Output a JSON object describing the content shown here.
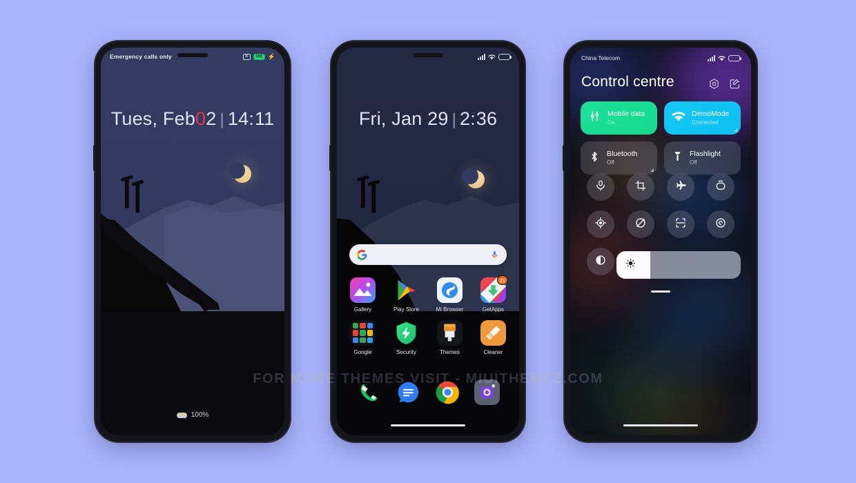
{
  "meta": {
    "background_color": "#a8b4fb",
    "watermark": "FOR MORE THEMES VISIT - MIUITHEMEZ.COM"
  },
  "lockscreen": {
    "statusbar": {
      "carrier": "Emergency calls only",
      "sim_icon": "no-sim-icon",
      "battery_level": "100",
      "charging_icon": "charging-bolt-icon"
    },
    "clock": {
      "weekday_month": "Tues, Feb",
      "day_red": "0",
      "day_rest": "2",
      "separator": "|",
      "hours": "14",
      "colon": ":",
      "minutes": "11"
    },
    "footer": {
      "battery_icon": "battery-charging-icon",
      "battery_text": "100%"
    }
  },
  "homescreen": {
    "statusbar": {
      "signal_icon": "signal-bars-icon",
      "wifi_icon": "wifi-icon",
      "battery_icon": "battery-icon"
    },
    "clock": {
      "weekday_month": "Fri, Jan",
      "day": "29",
      "separator": "|",
      "hours": "2",
      "colon": ":",
      "minutes": "36"
    },
    "search": {
      "logo_icon": "google-g-icon",
      "mic_icon": "microphone-icon",
      "placeholder": ""
    },
    "apps": [
      {
        "label": "Gallery",
        "icon": "gallery-icon",
        "badge": ""
      },
      {
        "label": "Play Store",
        "icon": "play-store-icon",
        "badge": ""
      },
      {
        "label": "Mi Browser",
        "icon": "mi-browser-icon",
        "badge": ""
      },
      {
        "label": "GetApps",
        "icon": "getapps-icon",
        "badge": "21"
      },
      {
        "label": "Google",
        "icon": "google-folder-icon",
        "badge": ""
      },
      {
        "label": "Security",
        "icon": "security-icon",
        "badge": ""
      },
      {
        "label": "Themes",
        "icon": "themes-icon",
        "badge": ""
      },
      {
        "label": "Cleaner",
        "icon": "cleaner-icon",
        "badge": ""
      }
    ],
    "dock": [
      {
        "label": "Phone",
        "icon": "phone-icon"
      },
      {
        "label": "Messages",
        "icon": "messages-icon"
      },
      {
        "label": "Chrome",
        "icon": "chrome-icon"
      },
      {
        "label": "Camera",
        "icon": "camera-icon"
      }
    ]
  },
  "controlcentre": {
    "statusbar": {
      "carrier": "China Telecom",
      "signal_icon": "signal-bars-icon",
      "wifi_icon": "wifi-icon",
      "battery_icon": "battery-icon"
    },
    "title": "Control centre",
    "actions": [
      {
        "name": "settings-icon"
      },
      {
        "name": "edit-icon"
      }
    ],
    "big_tiles": [
      {
        "title": "Mobile data",
        "subtitle": "On",
        "icon": "mobile-data-icon",
        "state": "on",
        "accent": "#17dd92"
      },
      {
        "title": "DemoMode",
        "subtitle": "Connected",
        "icon": "wifi-icon",
        "state": "on",
        "accent": "#12c4f2"
      },
      {
        "title": "Bluetooth",
        "subtitle": "Off",
        "icon": "bluetooth-icon",
        "state": "off",
        "accent": "#bac0d4"
      },
      {
        "title": "Flashlight",
        "subtitle": "Off",
        "icon": "flashlight-icon",
        "state": "off",
        "accent": "#bac0d4"
      }
    ],
    "toggles": [
      {
        "name": "silent-mode-icon"
      },
      {
        "name": "screenshot-icon"
      },
      {
        "name": "airplane-mode-icon"
      },
      {
        "name": "battery-saver-icon"
      },
      {
        "name": "location-icon"
      },
      {
        "name": "auto-rotate-icon"
      },
      {
        "name": "scan-code-icon"
      },
      {
        "name": "do-not-disturb-icon"
      },
      {
        "name": "dark-mode-icon"
      }
    ],
    "brightness": {
      "icon": "brightness-sun-icon",
      "value": "27"
    }
  }
}
